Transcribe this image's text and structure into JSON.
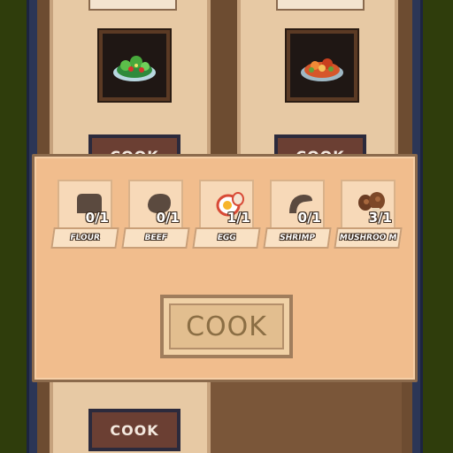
{
  "background": {
    "bg_color": "#2f3d0c",
    "frame_color": "#2c3656",
    "parchment_color": "#f1bd8d"
  },
  "recipes": {
    "left": {
      "dish_icon": "salad-icon",
      "cook_label": "COOK"
    },
    "right": {
      "dish_icon": "stew-icon",
      "cook_label": "COOK"
    },
    "bottom_left": {
      "cook_label": "COOK"
    }
  },
  "modal": {
    "ingredients": [
      {
        "name": "FLOUR",
        "count": "0/1",
        "icon": "flour-silhouette-icon"
      },
      {
        "name": "BEEF",
        "count": "0/1",
        "icon": "beef-silhouette-icon"
      },
      {
        "name": "EGG",
        "count": "1/1",
        "icon": "egg-icon"
      },
      {
        "name": "SHRIMP",
        "count": "0/1",
        "icon": "shrimp-silhouette-icon"
      },
      {
        "name": "MUSHROO M",
        "count": "3/1",
        "icon": "mushroom-icon"
      }
    ],
    "cook_label": "COOK"
  }
}
